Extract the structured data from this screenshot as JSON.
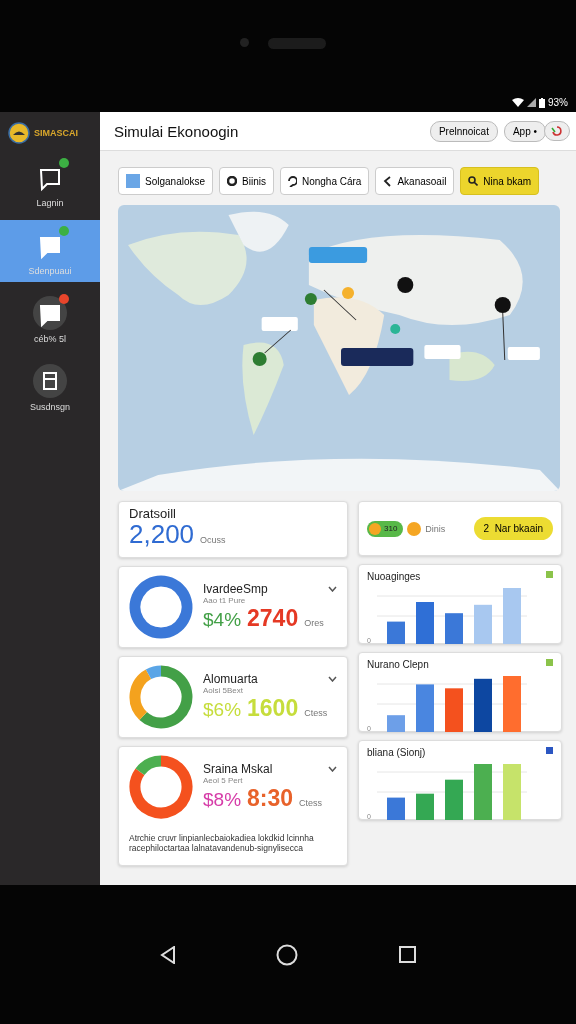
{
  "status_bar": {
    "battery": "93%"
  },
  "sidebar": {
    "logo_text": "SIMASCAI",
    "items": [
      {
        "label": "Lagnin",
        "selected": false,
        "badge": true
      },
      {
        "label": "Sdenpuaui",
        "selected": true,
        "badge": true
      },
      {
        "label": "céb% 5l",
        "selected": false,
        "badge": true
      },
      {
        "label": "Susdnsgn",
        "selected": false,
        "badge": false
      }
    ]
  },
  "header": {
    "title": "Simulai Ekonoogin",
    "buttons": [
      "Prelnnoicat",
      "App •"
    ]
  },
  "filters": [
    {
      "label": "Solganalokse",
      "kind": "square",
      "selected": false
    },
    {
      "label": "Biinis",
      "kind": "dot",
      "selected": false
    },
    {
      "label": "Nongha Cára",
      "kind": "pin",
      "selected": false
    },
    {
      "label": "Akanasoail",
      "kind": "back",
      "selected": false
    },
    {
      "label": "Nina bkam",
      "kind": "search",
      "selected": true
    }
  ],
  "stat": {
    "label": "Dratsoill",
    "value": "2,200",
    "unit": "Ocuss"
  },
  "status_card": {
    "pill": "310",
    "label": "Dinis",
    "button": "2  Nar bkaain"
  },
  "donut_cards": [
    {
      "title": "IvardeeSmp",
      "subtitle": "Aao t1 Pure",
      "percent": "$4%",
      "value": "2740",
      "unit": "Ores"
    },
    {
      "title": "Alomuarta",
      "subtitle": "Aolsi 5Bext",
      "percent": "$6%",
      "value": "1600",
      "unit": "Ctess"
    },
    {
      "title": "Sraina Mskal",
      "subtitle": "Aeol 5 Pert",
      "percent": "$8%",
      "value": "8:30",
      "unit": "Ctess",
      "note": "Atrchie cruvr linpianlecbaiokadiea lokdkid lcinnha racephiloctartaa lalnatavandenub-signylisecca"
    }
  ],
  "bar_cards": [
    {
      "title": "Nuoaginges",
      "zero": "0"
    },
    {
      "title": "Nurano Clepn",
      "zero": "0"
    },
    {
      "title": "bliana (Sionj)",
      "zero": "0"
    }
  ]
}
